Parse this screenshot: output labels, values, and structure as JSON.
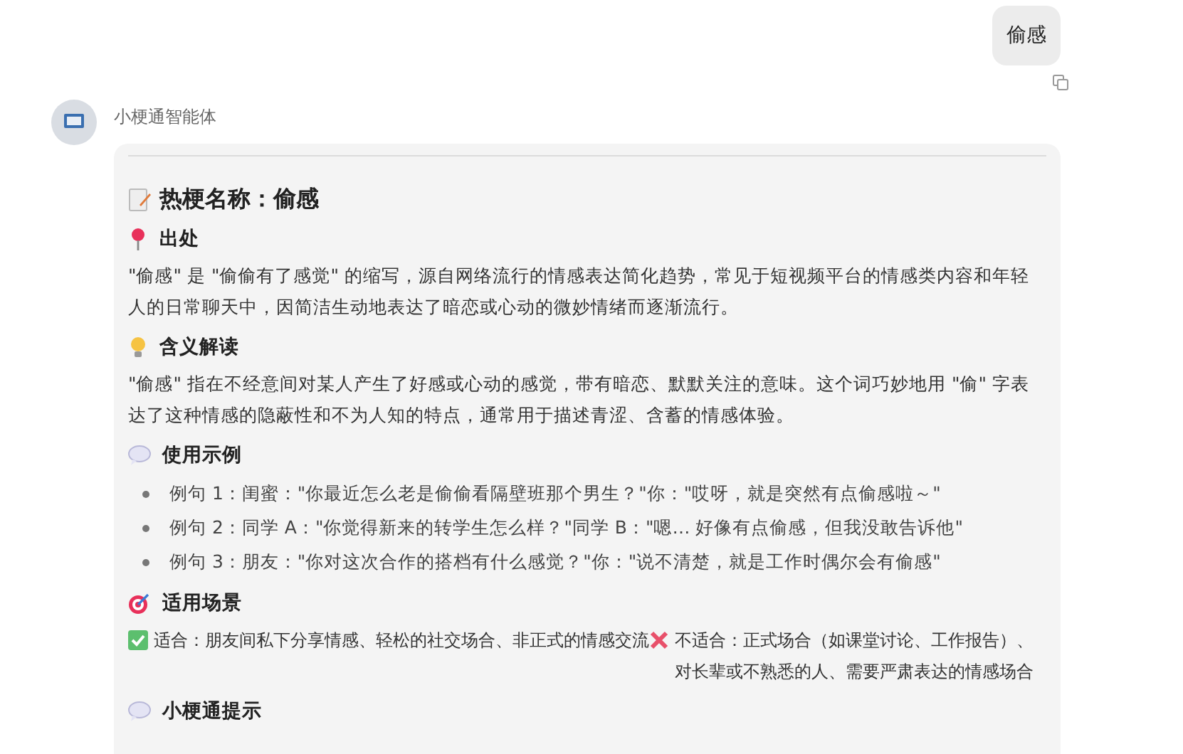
{
  "user_message": {
    "text": "偷感"
  },
  "assistant": {
    "name": "小梗通智能体"
  },
  "answer": {
    "title": "热梗名称：偷感",
    "sections": [
      {
        "kind": "paragraph",
        "heading": "出处",
        "text": "\"偷感\" 是 \"偷偷有了感觉\" 的缩写，源自网络流行的情感表达简化趋势，常见于短视频平台的情感类内容和年轻人的日常聊天中，因简洁生动地表达了暗恋或心动的微妙情绪而逐渐流行。"
      },
      {
        "kind": "paragraph",
        "heading": "含义解读",
        "text": "\"偷感\" 指在不经意间对某人产生了好感或心动的感觉，带有暗恋、默默关注的意味。这个词巧妙地用 \"偷\" 字表达了这种情感的隐蔽性和不为人知的特点，通常用于描述青涩、含蓄的情感体验。"
      },
      {
        "kind": "list",
        "heading": "使用示例",
        "items": [
          "例句 1：闺蜜：\"你最近怎么老是偷偷看隔壁班那个男生？\"你：\"哎呀，就是突然有点偷感啦～\"",
          "例句 2：同学 A：\"你觉得新来的转学生怎么样？\"同学 B：\"嗯… 好像有点偷感，但我没敢告诉他\"",
          "例句 3：朋友：\"你对这次合作的搭档有什么感觉？\"你：\"说不清楚，就是工作时偶尔会有偷感\""
        ]
      },
      {
        "kind": "scene",
        "heading": "适用场景",
        "suitable": "适合：朋友间私下分享情感、轻松的社交场合、非正式的情感交流",
        "unsuitable": "不适合：正式场合（如课堂讨论、工作报告）、对长辈或不熟悉的人、需要严肃表达的情感场合"
      },
      {
        "kind": "heading",
        "heading": "小梗通提示"
      }
    ]
  }
}
